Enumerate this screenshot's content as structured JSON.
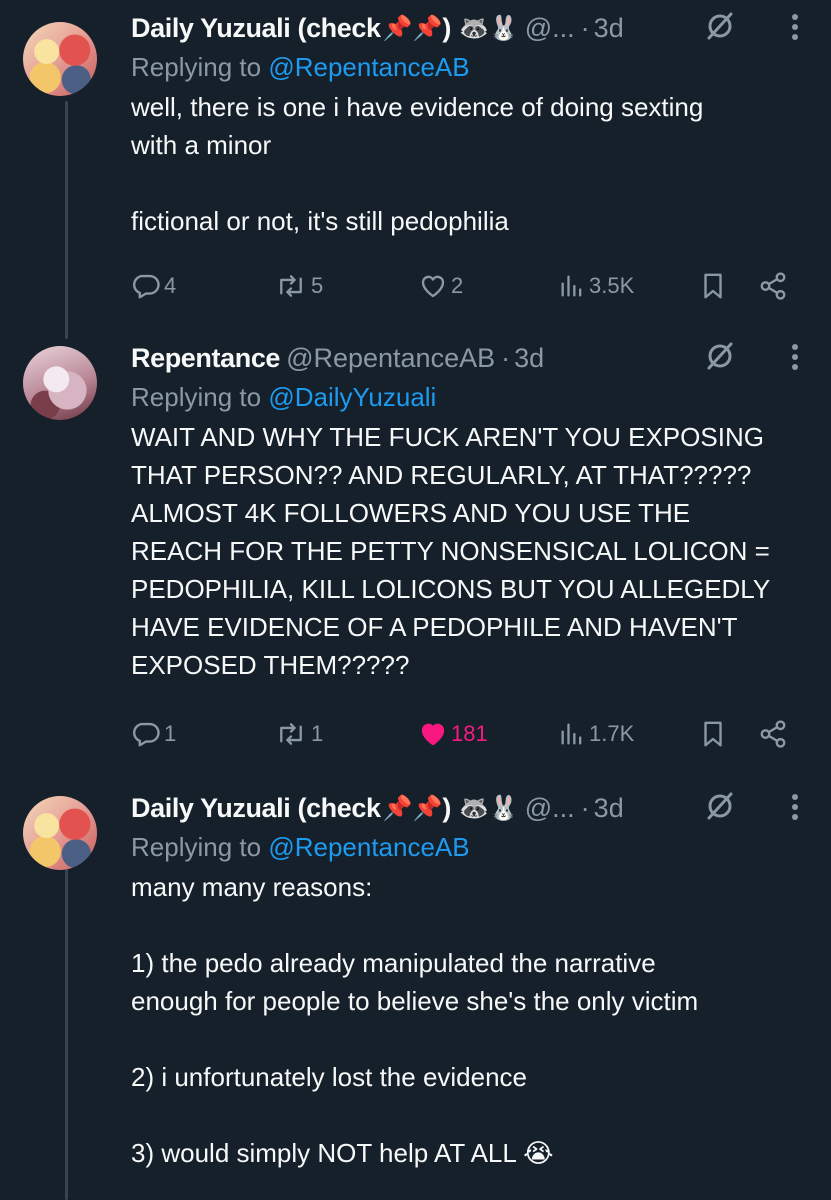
{
  "tweets": [
    {
      "display_name": "Daily Yuzuali (check",
      "name_suffix": ")",
      "name_emojis": "📌📌",
      "handle_emojis": "🦝🐰",
      "handle": "@...",
      "separator": "·",
      "time": "3d",
      "replying_prefix": "Replying to",
      "replying_to": "@RepentanceAB",
      "body": "well, there is one i have evidence of doing sexting\nwith a minor\n\nfictional or not, it's still pedophilia",
      "replies": "4",
      "reposts": "5",
      "likes": "2",
      "views": "3.5K",
      "liked": false
    },
    {
      "display_name": "Repentance",
      "name_suffix": "",
      "name_emojis": "",
      "handle_emojis": "",
      "handle": "@RepentanceAB",
      "separator": "·",
      "time": "3d",
      "replying_prefix": "Replying to",
      "replying_to": "@DailyYuzuali",
      "body": "WAIT AND WHY THE FUCK AREN'T YOU EXPOSING\nTHAT PERSON?? AND REGULARLY, AT THAT?????\nALMOST 4K FOLLOWERS AND YOU USE THE\nREACH FOR THE PETTY NONSENSICAL LOLICON =\nPEDOPHILIA, KILL LOLICONS BUT YOU ALLEGEDLY\nHAVE EVIDENCE OF A PEDOPHILE AND HAVEN'T\nEXPOSED THEM?????",
      "replies": "1",
      "reposts": "1",
      "likes": "181",
      "views": "1.7K",
      "liked": true
    },
    {
      "display_name": "Daily Yuzuali (check",
      "name_suffix": ")",
      "name_emojis": "📌📌",
      "handle_emojis": "🦝🐰",
      "handle": "@...",
      "separator": "·",
      "time": "3d",
      "replying_prefix": "Replying to",
      "replying_to": "@RepentanceAB",
      "body": "many many reasons:\n\n1) the pedo already manipulated the narrative\nenough for people to believe she's the only victim\n\n2) i unfortunately lost the evidence\n\n3) would simply NOT help AT ALL 😭"
    }
  ],
  "icons": {
    "reply": "reply-icon",
    "repost": "repost-icon",
    "like": "heart-icon",
    "views": "views-icon",
    "bookmark": "bookmark-icon",
    "share": "share-icon",
    "grok": "grok-icon",
    "more": "more-icon"
  },
  "colors": {
    "background": "#15202b",
    "text": "#f7f9f9",
    "muted": "#8b98a5",
    "link": "#1d9bf0",
    "like": "#f91880",
    "thread_line": "#38444d"
  }
}
